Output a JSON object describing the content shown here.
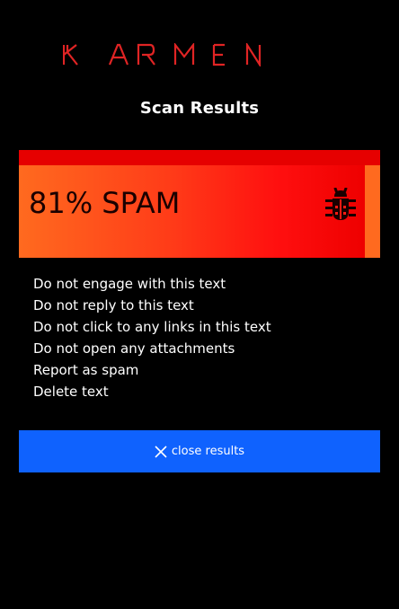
{
  "app": {
    "logo_text": "KARMEN",
    "brand_color": "#e02424"
  },
  "header": {
    "title": "Scan Results"
  },
  "result": {
    "label": "81% SPAM",
    "percent": 81,
    "icon": "bug-icon",
    "gradient_colors": [
      "#ff6a1f",
      "#ff0f0f",
      "#e60000"
    ]
  },
  "advice": {
    "items": [
      "Do not engage with this text",
      "Do not reply to this text",
      "Do not click to any links in this text",
      "Do not open any attachments",
      "Report as spam",
      "Delete text"
    ]
  },
  "actions": {
    "close_label": "close results",
    "close_icon": "close-icon",
    "button_color": "#0f62fe"
  }
}
